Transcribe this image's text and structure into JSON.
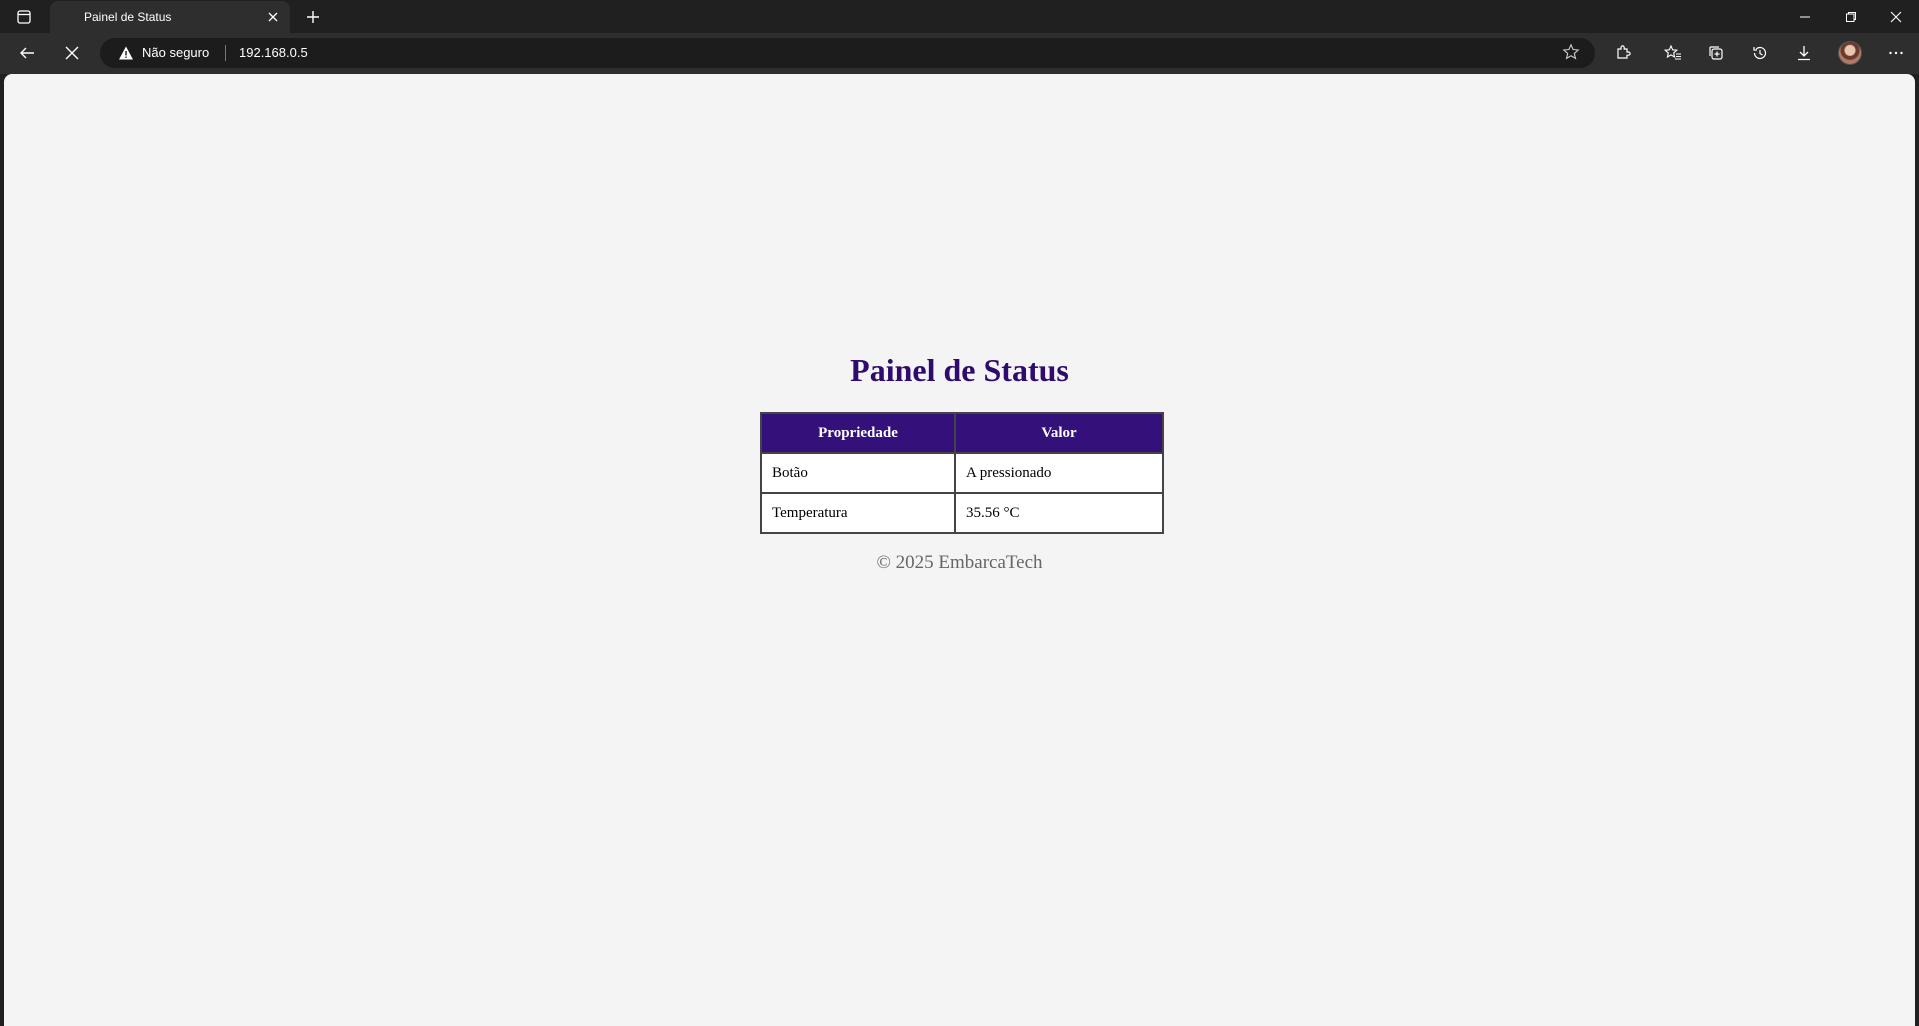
{
  "browser": {
    "tab": {
      "title": "Painel de Status"
    },
    "address_bar": {
      "security_label": "Não seguro",
      "url": "192.168.0.5"
    }
  },
  "page": {
    "heading": "Painel de Status",
    "table": {
      "headers": [
        "Propriedade",
        "Valor"
      ],
      "rows": [
        [
          "Botão",
          "A pressionado"
        ],
        [
          "Temperatura",
          "35.56 °C"
        ]
      ]
    },
    "footer": "© 2025 EmbarcaTech"
  },
  "colors": {
    "heading": "#2e0b6c",
    "table_header_bg": "#33107a",
    "page_bg": "#f4f4f4"
  }
}
